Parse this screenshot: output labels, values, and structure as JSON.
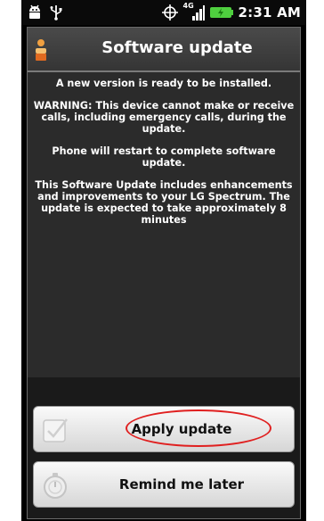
{
  "status_bar": {
    "time": "2:31 AM",
    "network_label": "4G",
    "icons": [
      "android-debug-icon",
      "usb-icon",
      "gps-icon",
      "4g-lte-icon",
      "signal-icon",
      "battery-charging-icon"
    ]
  },
  "dialog": {
    "title": "Software update",
    "title_icon": "person-icon",
    "messages": [
      "A new version is ready to be installed.",
      "WARNING: This device cannot make or receive calls, including emergency calls, during the update.",
      "Phone will restart to complete software update.",
      "This Software Update includes enhancements and improvements to your LG Spectrum. The update is expected to take approximately 8 minutes"
    ]
  },
  "buttons": {
    "apply_label": "Apply update",
    "apply_icon": "checkbox-icon",
    "remind_label": "Remind me later",
    "remind_icon": "timer-icon"
  },
  "colors": {
    "highlight": "#e02020",
    "dialog_background": "#2b2b2b"
  }
}
